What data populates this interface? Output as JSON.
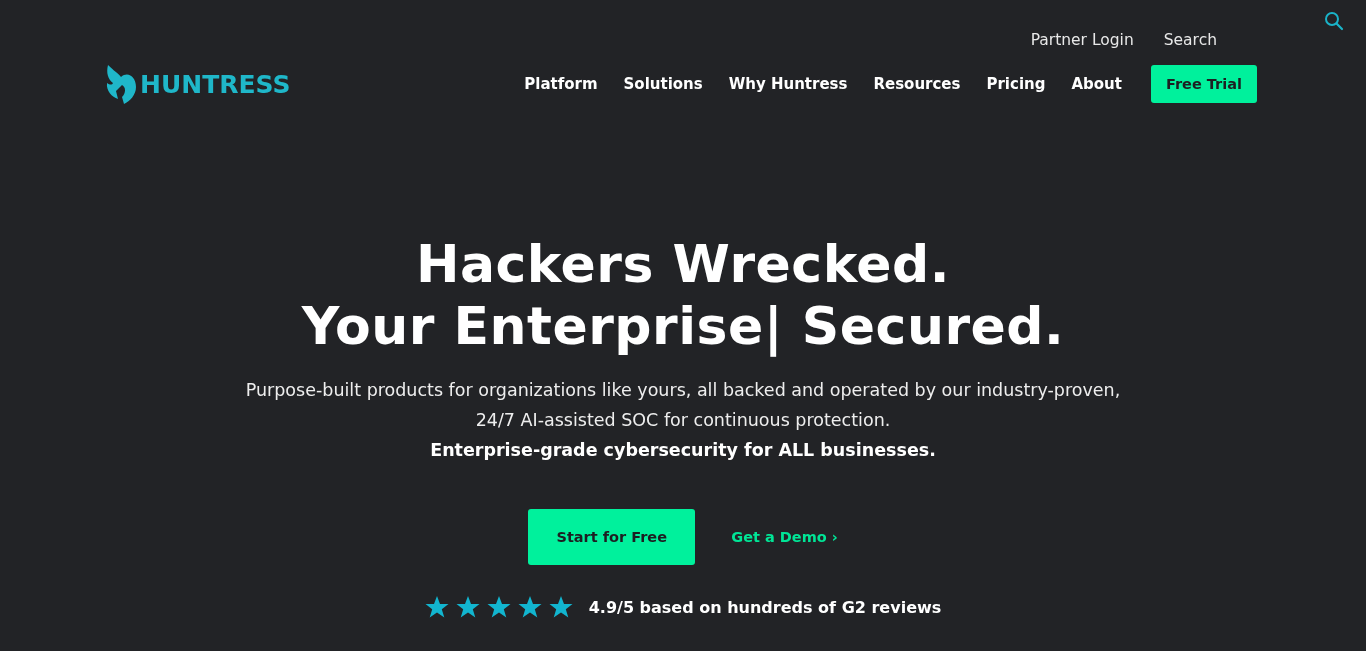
{
  "utility_nav": {
    "links": [
      "Partner Login",
      "Search"
    ]
  },
  "logo": {
    "text": "HUNTRESS"
  },
  "nav": {
    "items": [
      "Platform",
      "Solutions",
      "Why Huntress",
      "Resources",
      "Pricing",
      "About"
    ],
    "cta": "Free Trial"
  },
  "hero": {
    "headline": [
      "Hackers Wrecked.",
      "Your Enterprise| Secured."
    ],
    "description": "Purpose-built products for organizations like yours, all backed and operated by our industry-proven, 24/7 AI-assisted SOC for continuous protection.",
    "tagline": "Enterprise-grade cybersecurity for ALL businesses.",
    "primary_button": "Start for Free",
    "secondary_link": "Get a Demo ›",
    "rating": {
      "stars": 5,
      "text": "4.9/5 based on hundreds of G2 reviews"
    }
  }
}
